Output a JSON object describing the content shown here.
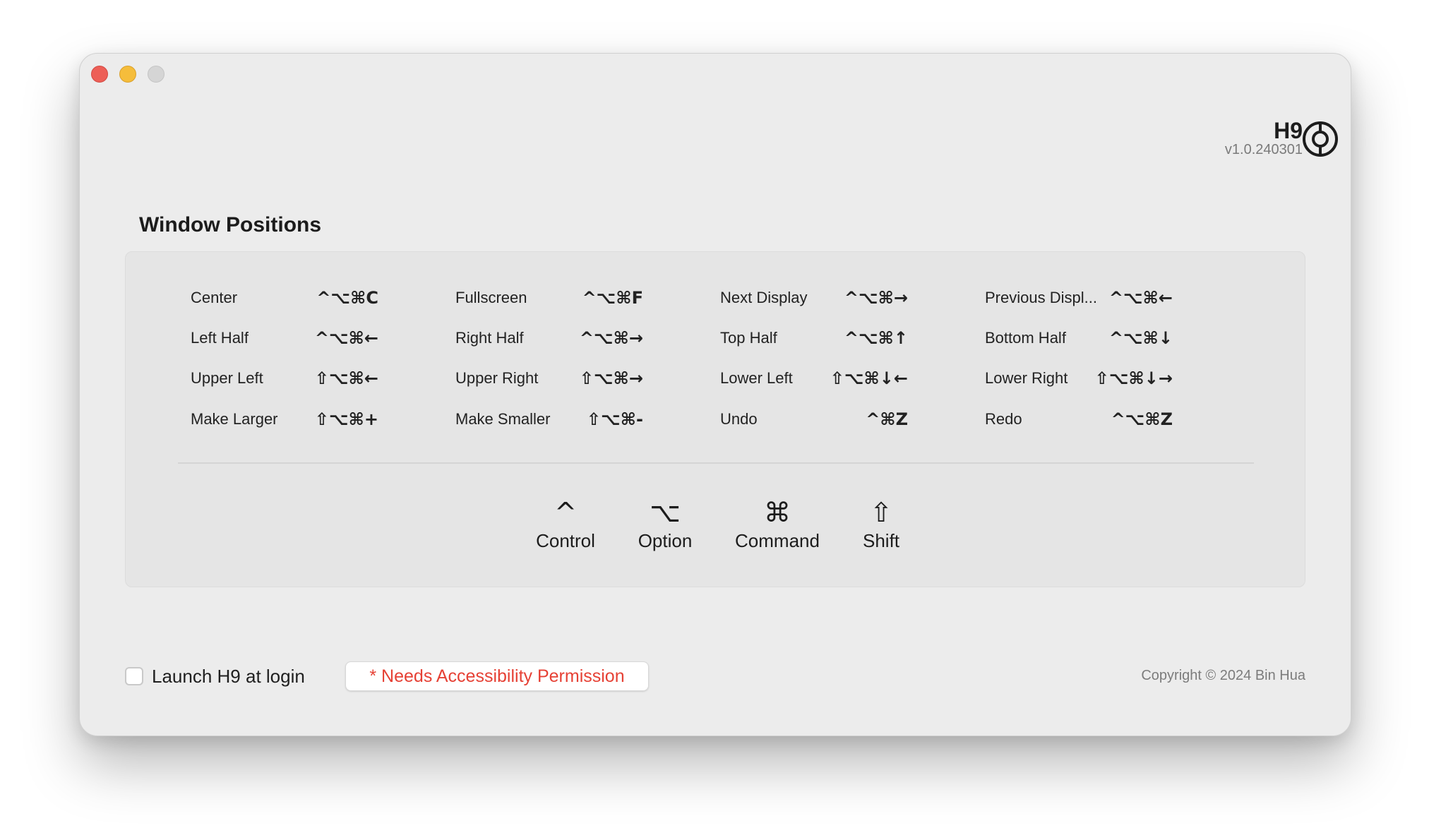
{
  "window": {
    "controls": [
      "close",
      "minimize",
      "zoom"
    ]
  },
  "brand": {
    "name": "H9",
    "version": "v1.0.240301",
    "logo_icon": "target-icon"
  },
  "section": {
    "title": "Window Positions"
  },
  "shortcuts": {
    "rows": [
      [
        {
          "label": "Center",
          "keys": "^⌥⌘C"
        },
        {
          "label": "Fullscreen",
          "keys": "^⌥⌘F"
        },
        {
          "label": "Next Display",
          "keys": "^⌥⌘→"
        },
        {
          "label": "Previous Displ...",
          "keys": "^⌥⌘←"
        }
      ],
      [
        {
          "label": "Left Half",
          "keys": "^⌥⌘←"
        },
        {
          "label": "Right Half",
          "keys": "^⌥⌘→"
        },
        {
          "label": "Top Half",
          "keys": "^⌥⌘↑"
        },
        {
          "label": "Bottom Half",
          "keys": "^⌥⌘↓"
        }
      ],
      [
        {
          "label": "Upper Left",
          "keys": "⇧⌥⌘←"
        },
        {
          "label": "Upper Right",
          "keys": "⇧⌥⌘→"
        },
        {
          "label": "Lower Left",
          "keys": "⇧⌥⌘↓←"
        },
        {
          "label": "Lower Right",
          "keys": "⇧⌥⌘↓→"
        }
      ],
      [
        {
          "label": "Make Larger",
          "keys": "⇧⌥⌘+"
        },
        {
          "label": "Make Smaller",
          "keys": "⇧⌥⌘-"
        },
        {
          "label": "Undo",
          "keys": "^⌘Z"
        },
        {
          "label": "Redo",
          "keys": "^⌥⌘Z"
        }
      ]
    ]
  },
  "legend": [
    {
      "symbol": "^",
      "name": "Control"
    },
    {
      "symbol": "⌥",
      "name": "Option"
    },
    {
      "symbol": "⌘",
      "name": "Command"
    },
    {
      "symbol": "⇧",
      "name": "Shift"
    }
  ],
  "footer": {
    "launch_label": "Launch H9 at login",
    "launch_checked": false,
    "permission_label": "* Needs Accessibility Permission",
    "permission_color": "#e64135",
    "copyright": "Copyright © 2024 Bin Hua"
  }
}
